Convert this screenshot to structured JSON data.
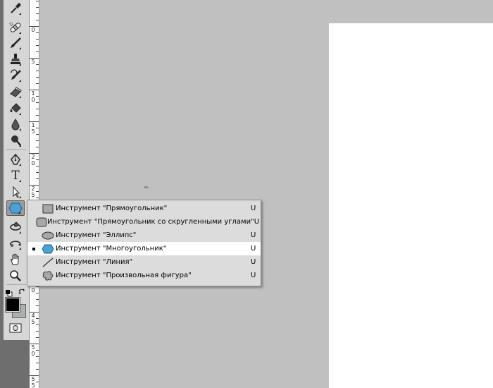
{
  "flyout_menu": {
    "items": [
      {
        "label": "Инструмент \"Прямоугольник\"",
        "shortcut": "U",
        "icon": "rectangle-icon",
        "selected": false
      },
      {
        "label": "Инструмент \"Прямоугольник со скругленными углами\"",
        "shortcut": "U",
        "icon": "rounded-rectangle-icon",
        "selected": false
      },
      {
        "label": "Инструмент \"Эллипс\"",
        "shortcut": "U",
        "icon": "ellipse-icon",
        "selected": false
      },
      {
        "label": "Инструмент \"Многоугольник\"",
        "shortcut": "U",
        "icon": "polygon-icon",
        "selected": true
      },
      {
        "label": "Инструмент \"Линия\"",
        "shortcut": "U",
        "icon": "line-icon",
        "selected": false
      },
      {
        "label": "Инструмент \"Произвольная фигура\"",
        "shortcut": "U",
        "icon": "custom-shape-icon",
        "selected": false
      }
    ]
  },
  "toolbar": {
    "tools": [
      "eyedropper-icon",
      "healing-brush-icon",
      "brush-icon",
      "clone-stamp-icon",
      "history-brush-icon",
      "eraser-icon",
      "paint-bucket-icon",
      "blur-icon",
      "dodge-icon",
      "pen-icon",
      "type-icon",
      "path-selection-icon",
      "polygon-icon",
      "3d-rotate-icon",
      "3d-orbit-icon",
      "hand-icon",
      "zoom-icon"
    ],
    "type_tool_glyph": "T",
    "active_tool": "polygon-icon",
    "foreground_color": "#000000",
    "background_color": "#a9b0ae",
    "accent_color": "#4aa3d6"
  },
  "ruler": {
    "labels": [
      "0",
      "5",
      "1\n0",
      "1\n5",
      "2\n0",
      "2\n5",
      "3\n0",
      "3\n5",
      "4\n0",
      "4\n5",
      "5\n0",
      "5\n5"
    ]
  }
}
